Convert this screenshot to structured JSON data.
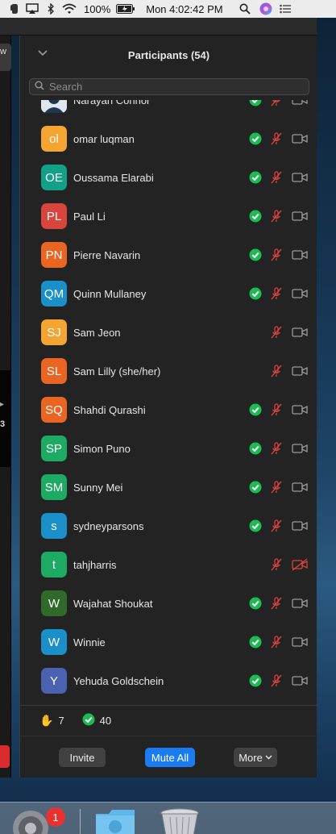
{
  "menubar": {
    "battery": "100%",
    "clock": "Mon 4:02:42 PM",
    "icons": [
      "evernote-icon",
      "airplay-icon",
      "bluetooth-icon",
      "wifi-icon",
      "battery-icon",
      "spotlight-icon",
      "siri-icon",
      "notification-center-icon"
    ]
  },
  "left_window": {
    "tab_label": "w",
    "glyph_arrow": "▸",
    "glyph_number": "3"
  },
  "panel": {
    "title": "Participants (54)",
    "search_placeholder": "Search",
    "participants": [
      {
        "initials": "",
        "name": "Narayan Connor",
        "color": "#27496b",
        "checked": true,
        "mic_muted": true,
        "video_off": false,
        "photo": true
      },
      {
        "initials": "ol",
        "name": "omar luqman",
        "color": "#f3a431",
        "checked": true,
        "mic_muted": true,
        "video_off": false
      },
      {
        "initials": "OE",
        "name": "Oussama Elarabi",
        "color": "#13a088",
        "checked": true,
        "mic_muted": true,
        "video_off": false
      },
      {
        "initials": "PL",
        "name": "Paul Li",
        "color": "#d7453c",
        "checked": true,
        "mic_muted": true,
        "video_off": false
      },
      {
        "initials": "PN",
        "name": "Pierre Navarin",
        "color": "#ea6522",
        "checked": true,
        "mic_muted": true,
        "video_off": false
      },
      {
        "initials": "QM",
        "name": "Quinn Mullaney",
        "color": "#1a8fc8",
        "checked": true,
        "mic_muted": true,
        "video_off": false
      },
      {
        "initials": "SJ",
        "name": "Sam Jeon",
        "color": "#f3a431",
        "checked": false,
        "mic_muted": true,
        "video_off": false
      },
      {
        "initials": "SL",
        "name": "Sam Lilly (she/her)",
        "color": "#ea6522",
        "checked": false,
        "mic_muted": true,
        "video_off": false
      },
      {
        "initials": "SQ",
        "name": "Shahdi Qurashi",
        "color": "#ea6522",
        "checked": true,
        "mic_muted": true,
        "video_off": false
      },
      {
        "initials": "SP",
        "name": "Simon Puno",
        "color": "#1daa62",
        "checked": true,
        "mic_muted": true,
        "video_off": false
      },
      {
        "initials": "SM",
        "name": "Sunny Mei",
        "color": "#1daa62",
        "checked": true,
        "mic_muted": true,
        "video_off": false
      },
      {
        "initials": "s",
        "name": "sydneyparsons",
        "color": "#1a8fc8",
        "checked": true,
        "mic_muted": true,
        "video_off": false
      },
      {
        "initials": "t",
        "name": "tahjharris",
        "color": "#1daa62",
        "checked": false,
        "mic_muted": true,
        "video_off": true
      },
      {
        "initials": "W",
        "name": "Wajahat Shoukat",
        "color": "#2f6a2a",
        "checked": true,
        "mic_muted": true,
        "video_off": false
      },
      {
        "initials": "W",
        "name": "Winnie",
        "color": "#1a8fc8",
        "checked": true,
        "mic_muted": true,
        "video_off": false
      },
      {
        "initials": "Y",
        "name": "Yehuda Goldschein",
        "color": "#4a62b0",
        "checked": true,
        "mic_muted": true,
        "video_off": false
      }
    ],
    "stats": {
      "raised_hands": "7",
      "checked": "40"
    },
    "buttons": {
      "invite": "Invite",
      "mute_all": "Mute All",
      "more": "More"
    }
  },
  "dock": {
    "badge": "1",
    "icons": [
      "system-preferences-icon",
      "finder-folder-icon",
      "trash-icon"
    ]
  },
  "colors": {
    "check_green": "#1db954",
    "muted_red": "#d9453c",
    "accent_blue": "#1a7cf0"
  }
}
